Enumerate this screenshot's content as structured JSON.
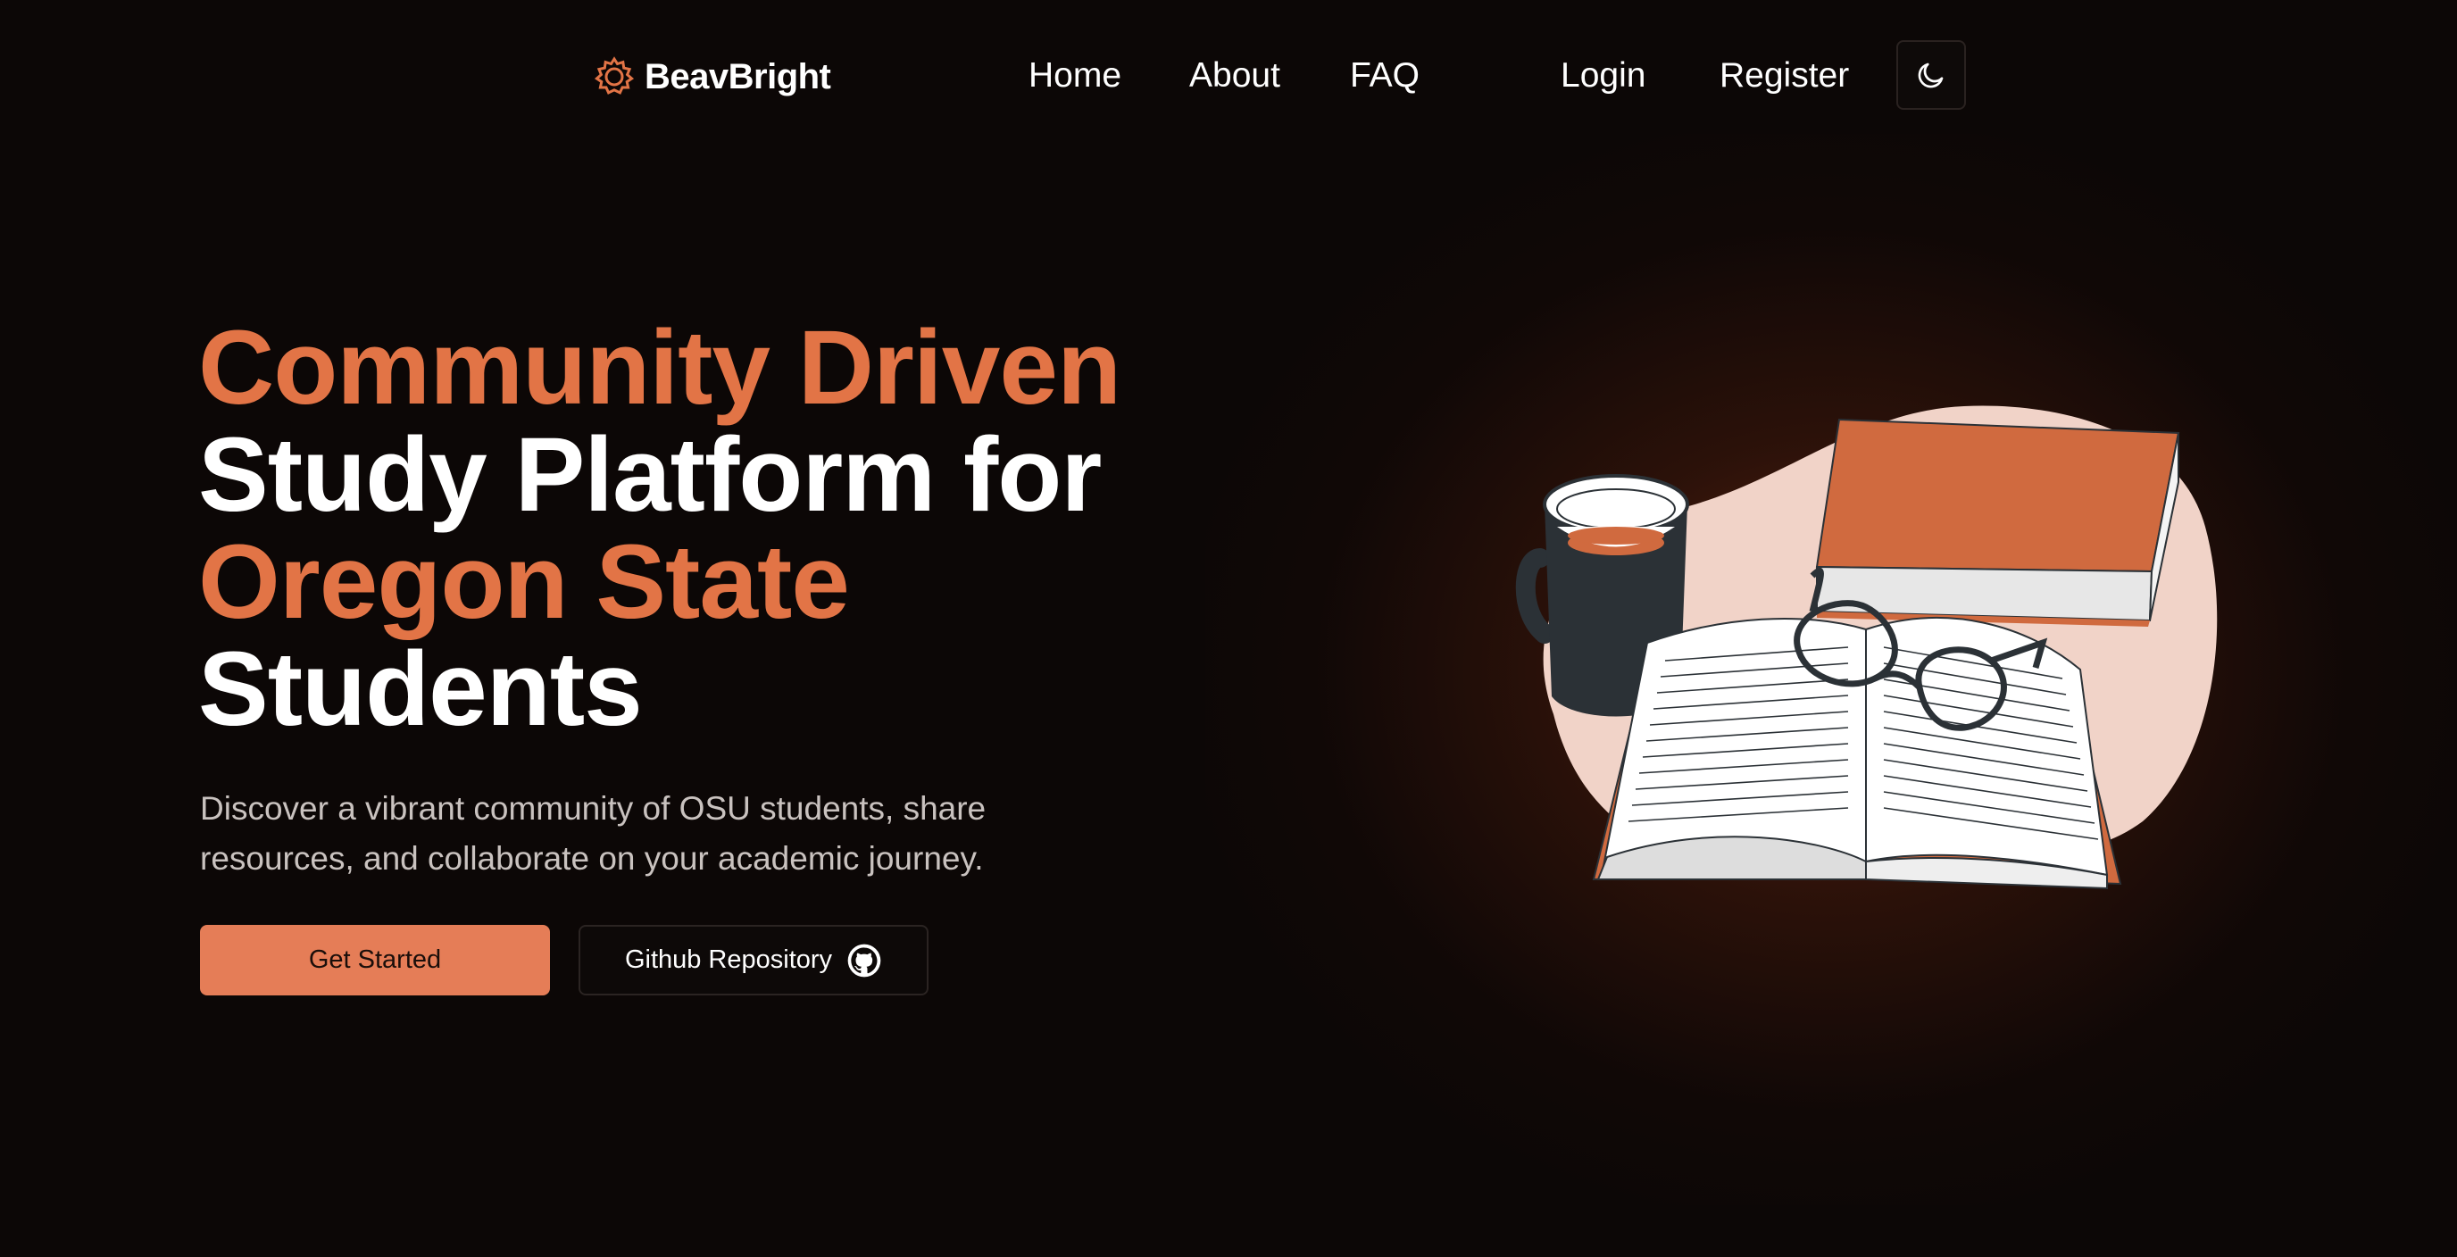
{
  "nav": {
    "brand": "BeavBright",
    "links": [
      {
        "label": "Home"
      },
      {
        "label": "About"
      },
      {
        "label": "FAQ"
      }
    ],
    "login": "Login",
    "register": "Register",
    "theme_icon": "moon-icon"
  },
  "hero": {
    "headline": {
      "line1": "Community Driven",
      "line2": "Study Platform for",
      "line3": "Oregon State",
      "line4": "Students"
    },
    "subtitle_line1": "Discover a vibrant community of OSU students, share",
    "subtitle_line2": "resources, and collaborate on your academic journey.",
    "primary_button": "Get Started",
    "secondary_button": "Github Repository",
    "secondary_icon": "github-icon"
  },
  "colors": {
    "accent": "#e27446",
    "button": "#e57d57",
    "background": "#0c0706",
    "blob": "#f1d3c8"
  }
}
